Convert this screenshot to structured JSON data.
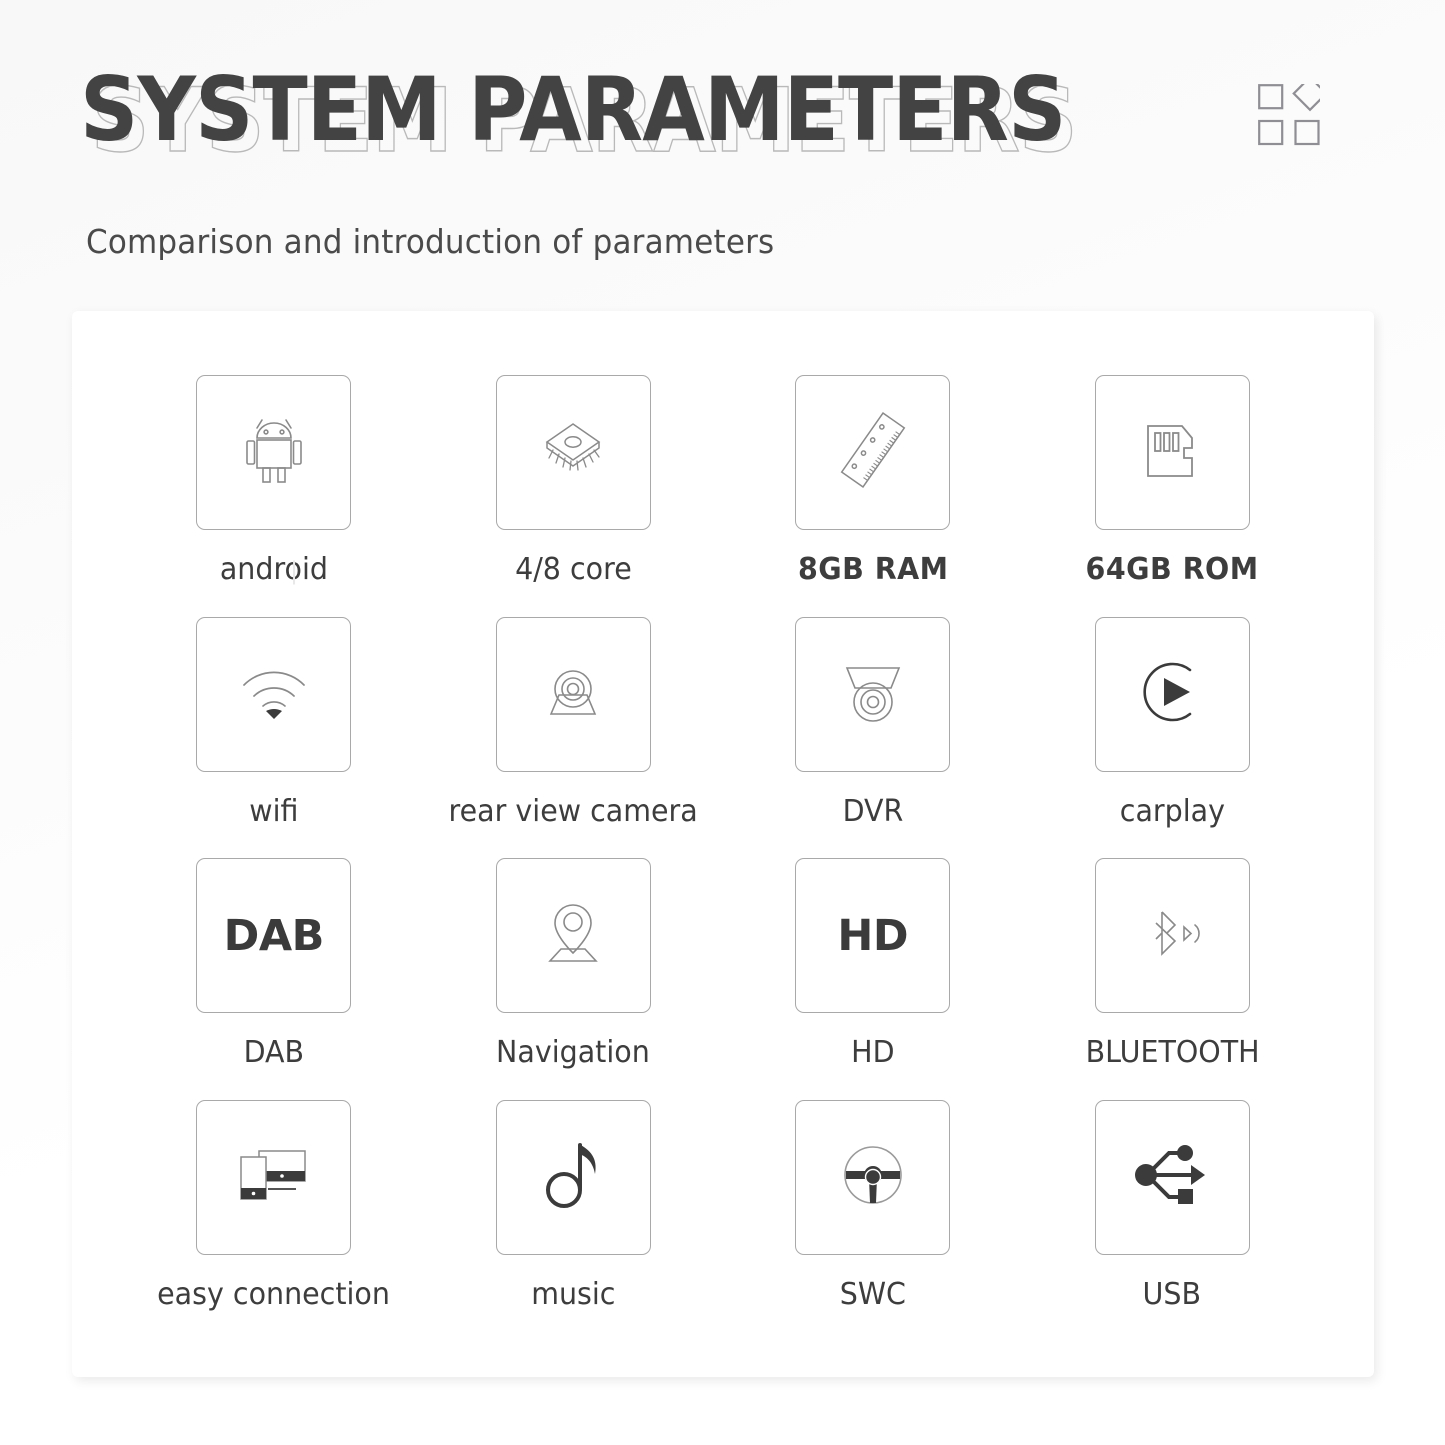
{
  "header": {
    "title": "SYSTEM PARAMETERS",
    "subtitle": "Comparison and introduction of parameters",
    "grid_icon_name": "grid-diamond-icon"
  },
  "colors": {
    "title": "#434343",
    "title_outline": "#b9b9b9",
    "text": "#3d3d3d",
    "tile_border": "#a9a9a9",
    "icon_stroke": "#8a8a8a",
    "icon_dark": "#3b3b3b",
    "page_bg": "#fbfbfb",
    "card_bg": "#ffffff"
  },
  "artifact": {
    "ghost_mark": "|"
  },
  "grid": {
    "columns": 4,
    "rows": 4,
    "items": [
      {
        "label": "android",
        "icon": "android-robot-icon",
        "bold": false,
        "tile_text": ""
      },
      {
        "label": "4/8  core",
        "icon": "cpu-chip-icon",
        "bold": false,
        "tile_text": ""
      },
      {
        "label": "8GB  RAM",
        "icon": "ram-stick-icon",
        "bold": true,
        "tile_text": ""
      },
      {
        "label": "64GB  ROM",
        "icon": "sd-card-icon",
        "bold": true,
        "tile_text": ""
      },
      {
        "label": "wifi",
        "icon": "wifi-icon",
        "bold": false,
        "tile_text": ""
      },
      {
        "label": "rear view camera",
        "icon": "rear-camera-icon",
        "bold": false,
        "tile_text": ""
      },
      {
        "label": "DVR",
        "icon": "dvr-camera-icon",
        "bold": false,
        "tile_text": ""
      },
      {
        "label": "carplay",
        "icon": "carplay-icon",
        "bold": false,
        "tile_text": ""
      },
      {
        "label": "DAB",
        "icon": "dab-text-icon",
        "bold": false,
        "tile_text": "DAB"
      },
      {
        "label": "Navigation",
        "icon": "map-pin-icon",
        "bold": false,
        "tile_text": ""
      },
      {
        "label": "HD",
        "icon": "hd-text-icon",
        "bold": false,
        "tile_text": "HD"
      },
      {
        "label": "BLUETOOTH",
        "icon": "bluetooth-audio-icon",
        "bold": false,
        "tile_text": ""
      },
      {
        "label": "easy connection",
        "icon": "screen-mirror-icon",
        "bold": false,
        "tile_text": ""
      },
      {
        "label": "music",
        "icon": "music-note-icon",
        "bold": false,
        "tile_text": ""
      },
      {
        "label": "SWC",
        "icon": "steering-wheel-icon",
        "bold": false,
        "tile_text": ""
      },
      {
        "label": "USB",
        "icon": "usb-icon",
        "bold": false,
        "tile_text": ""
      }
    ]
  }
}
